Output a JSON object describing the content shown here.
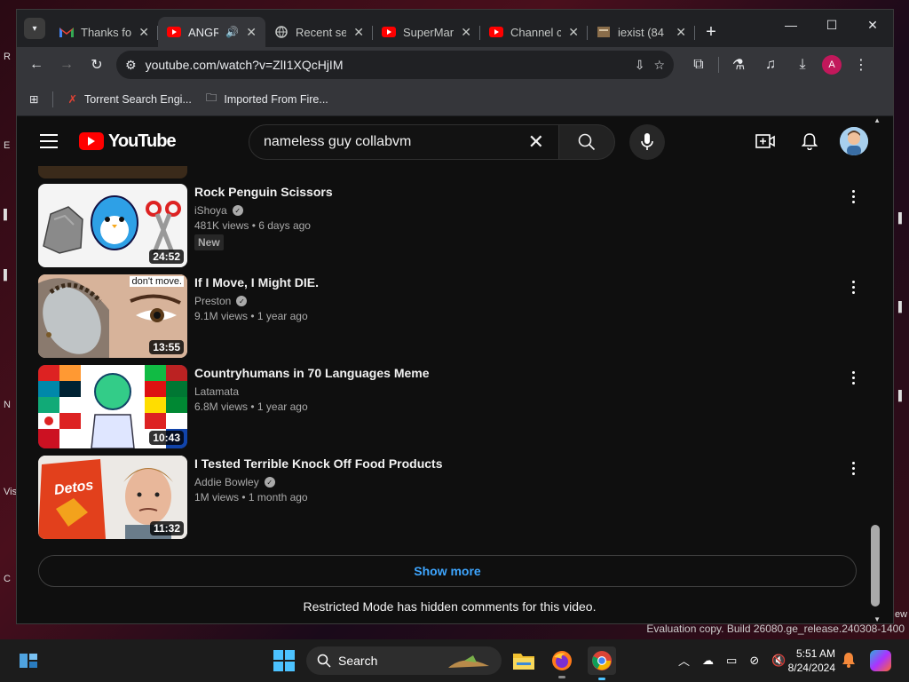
{
  "browser": {
    "tabs": [
      {
        "title": "Thanks fo",
        "icon": "gmail-icon",
        "active": false
      },
      {
        "title": "ANGR",
        "icon": "youtube-icon",
        "active": true,
        "audio": true
      },
      {
        "title": "Recent se",
        "icon": "globe-icon",
        "active": false
      },
      {
        "title": "SuperMar",
        "icon": "youtube-icon",
        "active": false
      },
      {
        "title": "Channel c",
        "icon": "youtube-icon",
        "active": false
      },
      {
        "title": "iexist (84",
        "icon": "page-icon",
        "active": false
      }
    ],
    "url": "youtube.com/watch?v=ZlI1XQcHjIM",
    "profile_initial": "A",
    "bookmarks": [
      {
        "label": "Torrent Search Engi...",
        "icon": "torrent-icon"
      },
      {
        "label": "Imported From Fire...",
        "icon": "folder-icon"
      }
    ]
  },
  "youtube": {
    "logo_text": "YouTube",
    "search_query": "nameless guy collabvm",
    "videos": [
      {
        "title": "Rock Penguin Scissors",
        "channel": "iShoya",
        "verified": true,
        "views": "481K views",
        "age": "6 days ago",
        "badge": "New",
        "duration": "24:52"
      },
      {
        "title": "If I Move, I Might DIE.",
        "channel": "Preston",
        "verified": true,
        "views": "9.1M views",
        "age": "1 year ago",
        "badge": "",
        "duration": "13:55",
        "thumb_text": "don't move."
      },
      {
        "title": "Countryhumans in 70 Languages Meme",
        "channel": "Latamata",
        "verified": false,
        "views": "6.8M views",
        "age": "1 year ago",
        "badge": "",
        "duration": "10:43"
      },
      {
        "title": "I Tested Terrible Knock Off Food Products",
        "channel": "Addie Bowley",
        "verified": true,
        "views": "1M views",
        "age": "1 month ago",
        "badge": "",
        "duration": "11:32",
        "thumb_text": "Detos"
      }
    ],
    "show_more": "Show more",
    "restricted_notice": "Restricted Mode has hidden comments for this video."
  },
  "desktop": {
    "evaluation_notice": "Evaluation copy. Build 26080.ge_release.240308-1400"
  },
  "taskbar": {
    "search_label": "Search",
    "time": "5:51 AM",
    "date": "8/24/2024"
  },
  "colors": {
    "accent_link": "#3ea6ff",
    "youtube_red": "#ff0000",
    "page_bg": "#0f0f0f"
  }
}
